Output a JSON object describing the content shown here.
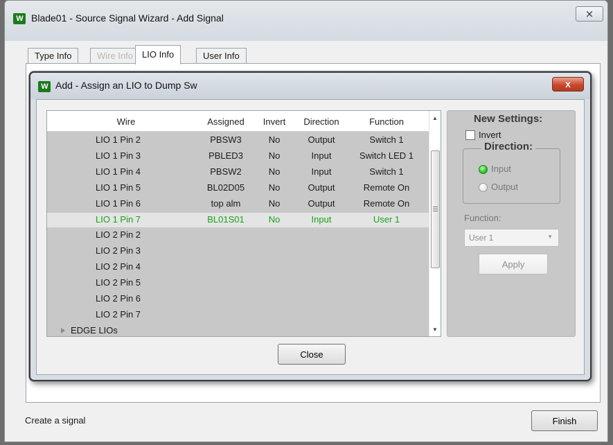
{
  "window": {
    "title": "Blade01 - Source Signal Wizard - Add Signal",
    "close_glyph": "⨯",
    "icon": "app-logo-icon"
  },
  "tabs": [
    {
      "label": "Type Info",
      "state": "normal"
    },
    {
      "label": "Wire Info",
      "state": "faded"
    },
    {
      "label": "LIO Info",
      "state": "active"
    },
    {
      "label": "User Info",
      "state": "normal"
    }
  ],
  "status": {
    "text": "Create a signal"
  },
  "finish_label": "Finish",
  "dialog": {
    "title": "Add - Assign an LIO to Dump Sw",
    "close_glyph": "x",
    "close_label": "Close",
    "columns": [
      "Wire",
      "Assigned",
      "Invert",
      "Direction",
      "Function"
    ],
    "rows": [
      {
        "wire": "LIO 1 Pin 2",
        "assigned": "PBSW3",
        "invert": "No",
        "direction": "Output",
        "function": "Switch 1"
      },
      {
        "wire": "LIO 1 Pin 3",
        "assigned": "PBLED3",
        "invert": "No",
        "direction": "Input",
        "function": "Switch LED 1"
      },
      {
        "wire": "LIO 1 Pin 4",
        "assigned": "PBSW2",
        "invert": "No",
        "direction": "Input",
        "function": "Switch 1"
      },
      {
        "wire": "LIO 1 Pin 5",
        "assigned": "BL02D05",
        "invert": "No",
        "direction": "Output",
        "function": "Remote On"
      },
      {
        "wire": "LIO 1 Pin 6",
        "assigned": "top alm",
        "invert": "No",
        "direction": "Output",
        "function": "Remote On"
      },
      {
        "wire": "LIO 1 Pin 7",
        "assigned": "BL01S01",
        "invert": "No",
        "direction": "Input",
        "function": "User 1",
        "selected": true
      },
      {
        "wire": "LIO 2 Pin 2",
        "assigned": "",
        "invert": "",
        "direction": "",
        "function": ""
      },
      {
        "wire": "LIO 2 Pin 3",
        "assigned": "",
        "invert": "",
        "direction": "",
        "function": ""
      },
      {
        "wire": "LIO 2 Pin 4",
        "assigned": "",
        "invert": "",
        "direction": "",
        "function": ""
      },
      {
        "wire": "LIO 2 Pin 5",
        "assigned": "",
        "invert": "",
        "direction": "",
        "function": ""
      },
      {
        "wire": "LIO 2 Pin 6",
        "assigned": "",
        "invert": "",
        "direction": "",
        "function": ""
      },
      {
        "wire": "LIO 2 Pin 7",
        "assigned": "",
        "invert": "",
        "direction": "",
        "function": ""
      }
    ],
    "group_row": {
      "label": "EDGE LIOs",
      "expanded": false
    },
    "settings": {
      "title": "New Settings:",
      "invert_label": "Invert",
      "invert_checked": false,
      "direction_title": "Direction:",
      "direction_options": [
        "Input",
        "Output"
      ],
      "direction_selected": "Input",
      "function_label": "Function:",
      "function_value": "User 1",
      "apply_label": "Apply"
    }
  },
  "colors": {
    "selected_text": "#17a317",
    "panel_gray": "#c8c8c8",
    "dialog_close": "#c74a2e"
  }
}
